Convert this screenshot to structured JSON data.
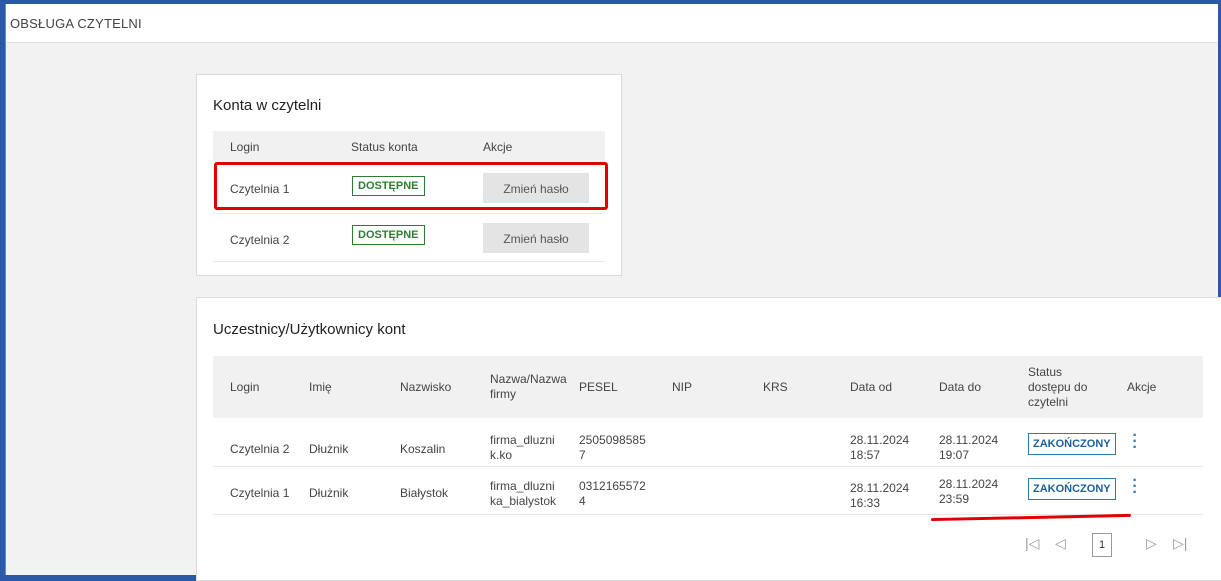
{
  "app": {
    "title": "OBSŁUGA CZYTELNI"
  },
  "accounts": {
    "title": "Konta w czytelni",
    "columns": [
      "Login",
      "Status konta",
      "Akcje"
    ],
    "rows": [
      {
        "login": "Czytelnia 1",
        "status": "DOSTĘPNE",
        "action": "Zmień hasło"
      },
      {
        "login": "Czytelnia 2",
        "status": "DOSTĘPNE",
        "action": "Zmień hasło"
      }
    ]
  },
  "participants": {
    "title": "Uczestnicy/Użytkownicy kont",
    "columns": {
      "login": "Login",
      "imie": "Imię",
      "nazwisko": "Nazwisko",
      "nazwa_l1": "Nazwa/Nazwa",
      "nazwa_l2": "firmy",
      "pesel": "PESEL",
      "nip": "NIP",
      "krs": "KRS",
      "data_od": "Data od",
      "data_do": "Data do",
      "status_l1": "Status",
      "status_l2": "dostępu do",
      "status_l3": "czytelni",
      "akcje": "Akcje"
    },
    "rows": [
      {
        "login": "Czytelnia 2",
        "imie": "Dłużnik",
        "nazwisko": "Koszalin",
        "nazwa_l1": "firma_dluzni",
        "nazwa_l2": "k.ko",
        "pesel_l1": "2505098585",
        "pesel_l2": "7",
        "nip": "",
        "krs": "",
        "od_date": "28.11.2024",
        "od_time": "18:57",
        "do_date": "28.11.2024",
        "do_time": "19:07",
        "status": "ZAKOŃCZONY"
      },
      {
        "login": "Czytelnia 1",
        "imie": "Dłużnik",
        "nazwisko": "Białystok",
        "nazwa_l1": "firma_dluzni",
        "nazwa_l2": "ka_bialystok",
        "pesel_l1": "0312165572",
        "pesel_l2": "4",
        "nip": "",
        "krs": "",
        "od_date": "28.11.2024",
        "od_time": "16:33",
        "do_date": "28.11.2024",
        "do_time": "23:59",
        "status": "ZAKOŃCZONY"
      }
    ],
    "pagination": {
      "current_page": "1"
    }
  },
  "icons": {
    "first": "first-page-icon",
    "prev": "prev-page-icon",
    "next": "next-page-icon",
    "last": "last-page-icon",
    "row_menu": "kebab-menu-icon"
  },
  "colors": {
    "available": "#2e7d32",
    "finished": "#2b7bb9",
    "annotation": "#e00000"
  }
}
